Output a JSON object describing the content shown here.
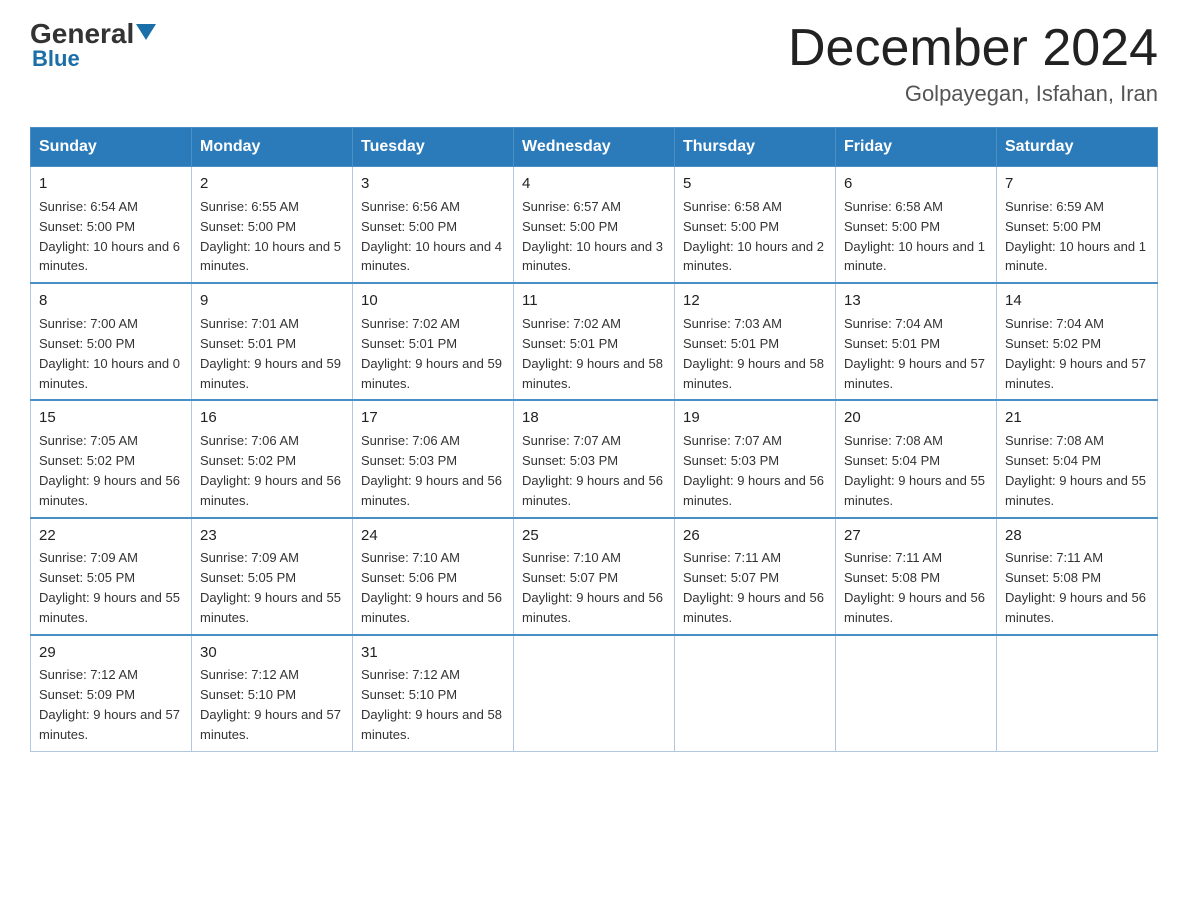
{
  "header": {
    "logo_general": "General",
    "logo_blue": "Blue",
    "month_title": "December 2024",
    "location": "Golpayegan, Isfahan, Iran"
  },
  "days_of_week": [
    "Sunday",
    "Monday",
    "Tuesday",
    "Wednesday",
    "Thursday",
    "Friday",
    "Saturday"
  ],
  "weeks": [
    [
      {
        "day": "1",
        "sunrise": "6:54 AM",
        "sunset": "5:00 PM",
        "daylight": "10 hours and 6 minutes."
      },
      {
        "day": "2",
        "sunrise": "6:55 AM",
        "sunset": "5:00 PM",
        "daylight": "10 hours and 5 minutes."
      },
      {
        "day": "3",
        "sunrise": "6:56 AM",
        "sunset": "5:00 PM",
        "daylight": "10 hours and 4 minutes."
      },
      {
        "day": "4",
        "sunrise": "6:57 AM",
        "sunset": "5:00 PM",
        "daylight": "10 hours and 3 minutes."
      },
      {
        "day": "5",
        "sunrise": "6:58 AM",
        "sunset": "5:00 PM",
        "daylight": "10 hours and 2 minutes."
      },
      {
        "day": "6",
        "sunrise": "6:58 AM",
        "sunset": "5:00 PM",
        "daylight": "10 hours and 1 minute."
      },
      {
        "day": "7",
        "sunrise": "6:59 AM",
        "sunset": "5:00 PM",
        "daylight": "10 hours and 1 minute."
      }
    ],
    [
      {
        "day": "8",
        "sunrise": "7:00 AM",
        "sunset": "5:00 PM",
        "daylight": "10 hours and 0 minutes."
      },
      {
        "day": "9",
        "sunrise": "7:01 AM",
        "sunset": "5:01 PM",
        "daylight": "9 hours and 59 minutes."
      },
      {
        "day": "10",
        "sunrise": "7:02 AM",
        "sunset": "5:01 PM",
        "daylight": "9 hours and 59 minutes."
      },
      {
        "day": "11",
        "sunrise": "7:02 AM",
        "sunset": "5:01 PM",
        "daylight": "9 hours and 58 minutes."
      },
      {
        "day": "12",
        "sunrise": "7:03 AM",
        "sunset": "5:01 PM",
        "daylight": "9 hours and 58 minutes."
      },
      {
        "day": "13",
        "sunrise": "7:04 AM",
        "sunset": "5:01 PM",
        "daylight": "9 hours and 57 minutes."
      },
      {
        "day": "14",
        "sunrise": "7:04 AM",
        "sunset": "5:02 PM",
        "daylight": "9 hours and 57 minutes."
      }
    ],
    [
      {
        "day": "15",
        "sunrise": "7:05 AM",
        "sunset": "5:02 PM",
        "daylight": "9 hours and 56 minutes."
      },
      {
        "day": "16",
        "sunrise": "7:06 AM",
        "sunset": "5:02 PM",
        "daylight": "9 hours and 56 minutes."
      },
      {
        "day": "17",
        "sunrise": "7:06 AM",
        "sunset": "5:03 PM",
        "daylight": "9 hours and 56 minutes."
      },
      {
        "day": "18",
        "sunrise": "7:07 AM",
        "sunset": "5:03 PM",
        "daylight": "9 hours and 56 minutes."
      },
      {
        "day": "19",
        "sunrise": "7:07 AM",
        "sunset": "5:03 PM",
        "daylight": "9 hours and 56 minutes."
      },
      {
        "day": "20",
        "sunrise": "7:08 AM",
        "sunset": "5:04 PM",
        "daylight": "9 hours and 55 minutes."
      },
      {
        "day": "21",
        "sunrise": "7:08 AM",
        "sunset": "5:04 PM",
        "daylight": "9 hours and 55 minutes."
      }
    ],
    [
      {
        "day": "22",
        "sunrise": "7:09 AM",
        "sunset": "5:05 PM",
        "daylight": "9 hours and 55 minutes."
      },
      {
        "day": "23",
        "sunrise": "7:09 AM",
        "sunset": "5:05 PM",
        "daylight": "9 hours and 55 minutes."
      },
      {
        "day": "24",
        "sunrise": "7:10 AM",
        "sunset": "5:06 PM",
        "daylight": "9 hours and 56 minutes."
      },
      {
        "day": "25",
        "sunrise": "7:10 AM",
        "sunset": "5:07 PM",
        "daylight": "9 hours and 56 minutes."
      },
      {
        "day": "26",
        "sunrise": "7:11 AM",
        "sunset": "5:07 PM",
        "daylight": "9 hours and 56 minutes."
      },
      {
        "day": "27",
        "sunrise": "7:11 AM",
        "sunset": "5:08 PM",
        "daylight": "9 hours and 56 minutes."
      },
      {
        "day": "28",
        "sunrise": "7:11 AM",
        "sunset": "5:08 PM",
        "daylight": "9 hours and 56 minutes."
      }
    ],
    [
      {
        "day": "29",
        "sunrise": "7:12 AM",
        "sunset": "5:09 PM",
        "daylight": "9 hours and 57 minutes."
      },
      {
        "day": "30",
        "sunrise": "7:12 AM",
        "sunset": "5:10 PM",
        "daylight": "9 hours and 57 minutes."
      },
      {
        "day": "31",
        "sunrise": "7:12 AM",
        "sunset": "5:10 PM",
        "daylight": "9 hours and 58 minutes."
      },
      null,
      null,
      null,
      null
    ]
  ],
  "labels": {
    "sunrise": "Sunrise:",
    "sunset": "Sunset:",
    "daylight": "Daylight:"
  }
}
